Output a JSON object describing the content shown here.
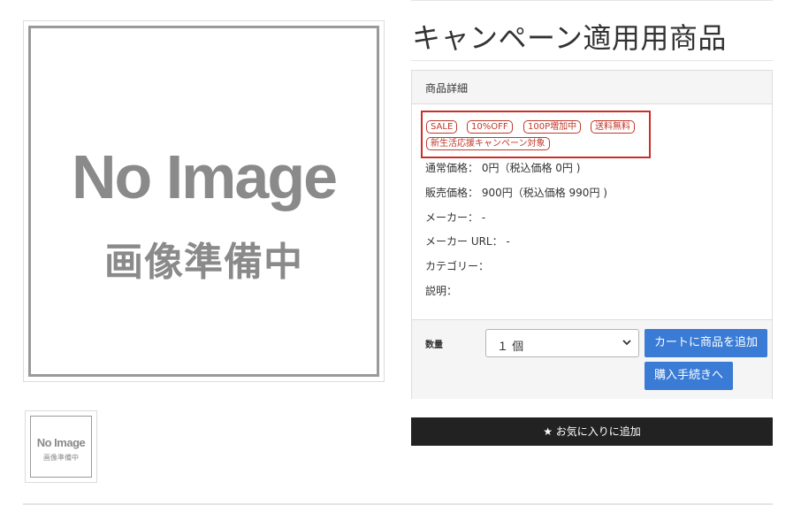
{
  "product": {
    "title": "キャンペーン適用用商品",
    "image": {
      "placeholder_main": "No Image",
      "placeholder_sub": "画像準備中"
    },
    "thumbnail": {
      "placeholder_main": "No Image",
      "placeholder_sub": "画像準備中"
    }
  },
  "detail_panel": {
    "heading": "商品詳細",
    "tags": [
      "SALE",
      "10%OFF",
      "100P増加中",
      "送料無料",
      "新生活応援キャンペーン対象"
    ],
    "rows": [
      "通常価格： 0円（税込価格 0円 )",
      "販売価格： 900円（税込価格 990円 )",
      "メーカー： -",
      "メーカー URL： -",
      "カテゴリー：",
      "説明："
    ]
  },
  "purchase": {
    "quantity_label": "数量",
    "quantity_value": "１ 個",
    "add_to_cart": "カートに商品を追加",
    "checkout": "購入手続きへ"
  },
  "favorite": {
    "icon": "star-icon",
    "label": "★ お気に入りに追加"
  },
  "colors": {
    "accent_blue": "#3a7bd5",
    "tag_red": "#c0392b",
    "dark_button": "#222222"
  }
}
